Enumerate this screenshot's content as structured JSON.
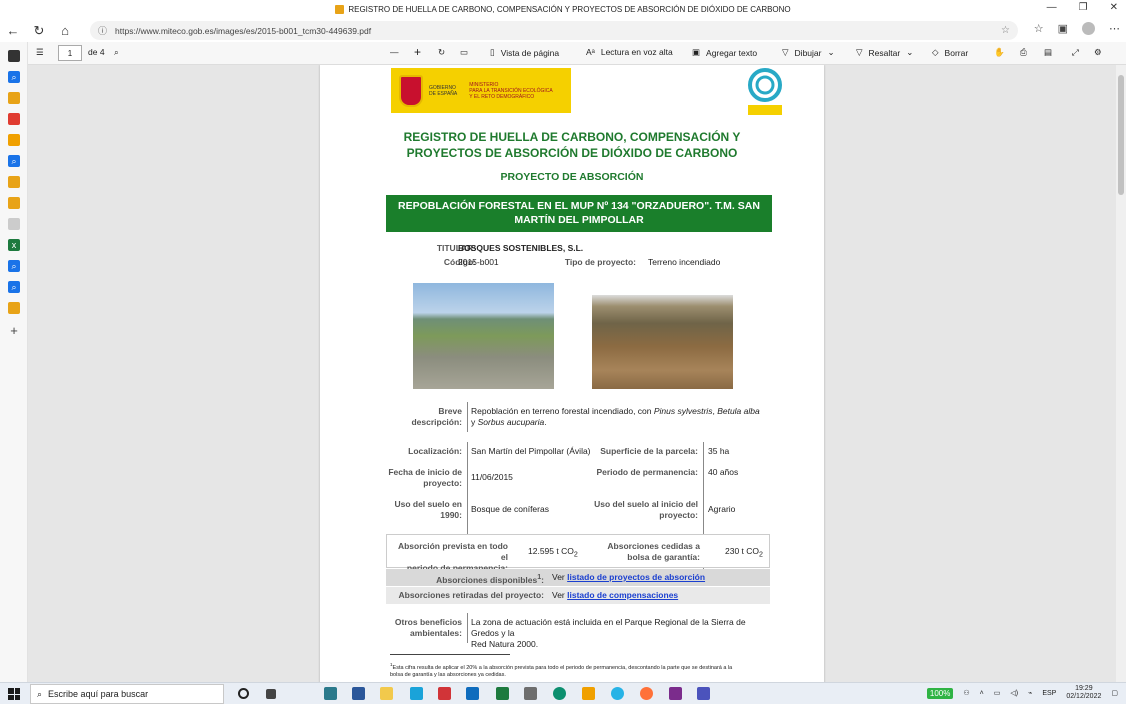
{
  "window": {
    "title": "REGISTRO DE HUELLA DE CARBONO, COMPENSACIÓN Y PROYECTOS DE ABSORCIÓN DE DIÓXIDO DE CARBONO"
  },
  "browser": {
    "url": "https://www.miteco.gob.es/images/es/2015-b001_tcm30-449639.pdf"
  },
  "pdf_toolbar": {
    "page_current": "1",
    "page_total": "de 4",
    "page_view": "Vista de página",
    "read_aloud": "Lectura en voz alta",
    "add_text": "Agregar texto",
    "draw": "Dibujar",
    "highlight": "Resaltar",
    "erase": "Borrar"
  },
  "document": {
    "gov": {
      "line1": "GOBIERNO",
      "line2": "DE ESPAÑA",
      "min1": "MINISTERIO",
      "min2": "PARA LA TRANSICIÓN ECOLÓGICA",
      "min3": "Y EL RETO DEMOGRÁFICO"
    },
    "title_line1": "REGISTRO DE HUELLA DE CARBONO, COMPENSACIÓN Y",
    "title_line2": "PROYECTOS DE ABSORCIÓN DE DIÓXIDO DE CARBONO",
    "project_type_heading": "PROYECTO DE ABSORCIÓN",
    "project_name_line1": "REPOBLACIÓN FORESTAL EN EL MUP Nº 134 \"ORZADUERO\". T.M. SAN",
    "project_name_line2": "MARTÍN DEL PIMPOLLAR",
    "titular_label": "TITULAR:",
    "titular_value": "BOSQUES SOSTENIBLES, S.L.",
    "codigo_label": "Código:",
    "codigo_value": "2015-b001",
    "tipo_label": "Tipo de proyecto:",
    "tipo_value": "Terreno incendiado",
    "desc_label": "Breve descripción:",
    "desc_line1_a": "Repoblación en terreno forestal incendiado, con ",
    "desc_line1_b": "Pinus sylvestris",
    "desc_line1_c": ", ",
    "desc_line1_d": "Betula alba",
    "desc_line2_a": "y ",
    "desc_line2_b": "Sorbus aucuparia",
    "desc_line2_c": ".",
    "loc_label": "Localización:",
    "loc_value": "San Martín del Pimpollar (Ávila)",
    "sup_label": "Superficie de la parcela:",
    "sup_value": "35 ha",
    "fecha_label1": "Fecha de inicio de",
    "fecha_label2": "proyecto:",
    "fecha_value": "11/06/2015",
    "perm_label": "Periodo de permanencia:",
    "perm_value": "40 años",
    "uso1990_label1": "Uso del suelo en",
    "uso1990_label2": "1990:",
    "uso1990_value": "Bosque de coníferas",
    "usoini_label1": "Uso del suelo al inicio del",
    "usoini_label2": "proyecto:",
    "usoini_value": "Agrario",
    "abs_prev_label1": "Absorción prevista en todo el",
    "abs_prev_label2": "periodo de permanencia:",
    "abs_prev_value": "12.595 t CO",
    "abs_ced_label1": "Absorciones cedidas a",
    "abs_ced_label2": "bolsa de garantía:",
    "abs_ced_value": "230 t CO",
    "co2_sub": "2",
    "disp_label": "Absorciones disponibles",
    "disp_sup": "1",
    "disp_colon": ":",
    "ver": "Ver",
    "disp_link": "listado de proyectos de absorción",
    "ret_label": "Absorciones retiradas del proyecto:",
    "ret_link": "listado de compensaciones",
    "otros_label1": "Otros beneficios",
    "otros_label2": "ambientales:",
    "otros_line1": "La zona de actuación está incluida en el Parque Regional de la Sierra de Gredos y la",
    "otros_line2": "Red Natura 2000.",
    "footnote_sup": "1",
    "footnote_line1": "Esta cifra resulta de aplicar el 20% a la absorción prevista para todo el periodo de permanencia, descontando la parte que se destinará a la",
    "footnote_line2": "bolsa de garantía y las absorciones ya cedidas."
  },
  "taskbar": {
    "search_placeholder": "Escribe aquí para buscar",
    "zoom": "100%",
    "lang": "ESP",
    "time": "19:29",
    "date": "02/12/2022"
  },
  "colors": {
    "green_title": "#1f7a2e",
    "green_bar": "#1a7f2b",
    "link": "#1a3fd0"
  }
}
